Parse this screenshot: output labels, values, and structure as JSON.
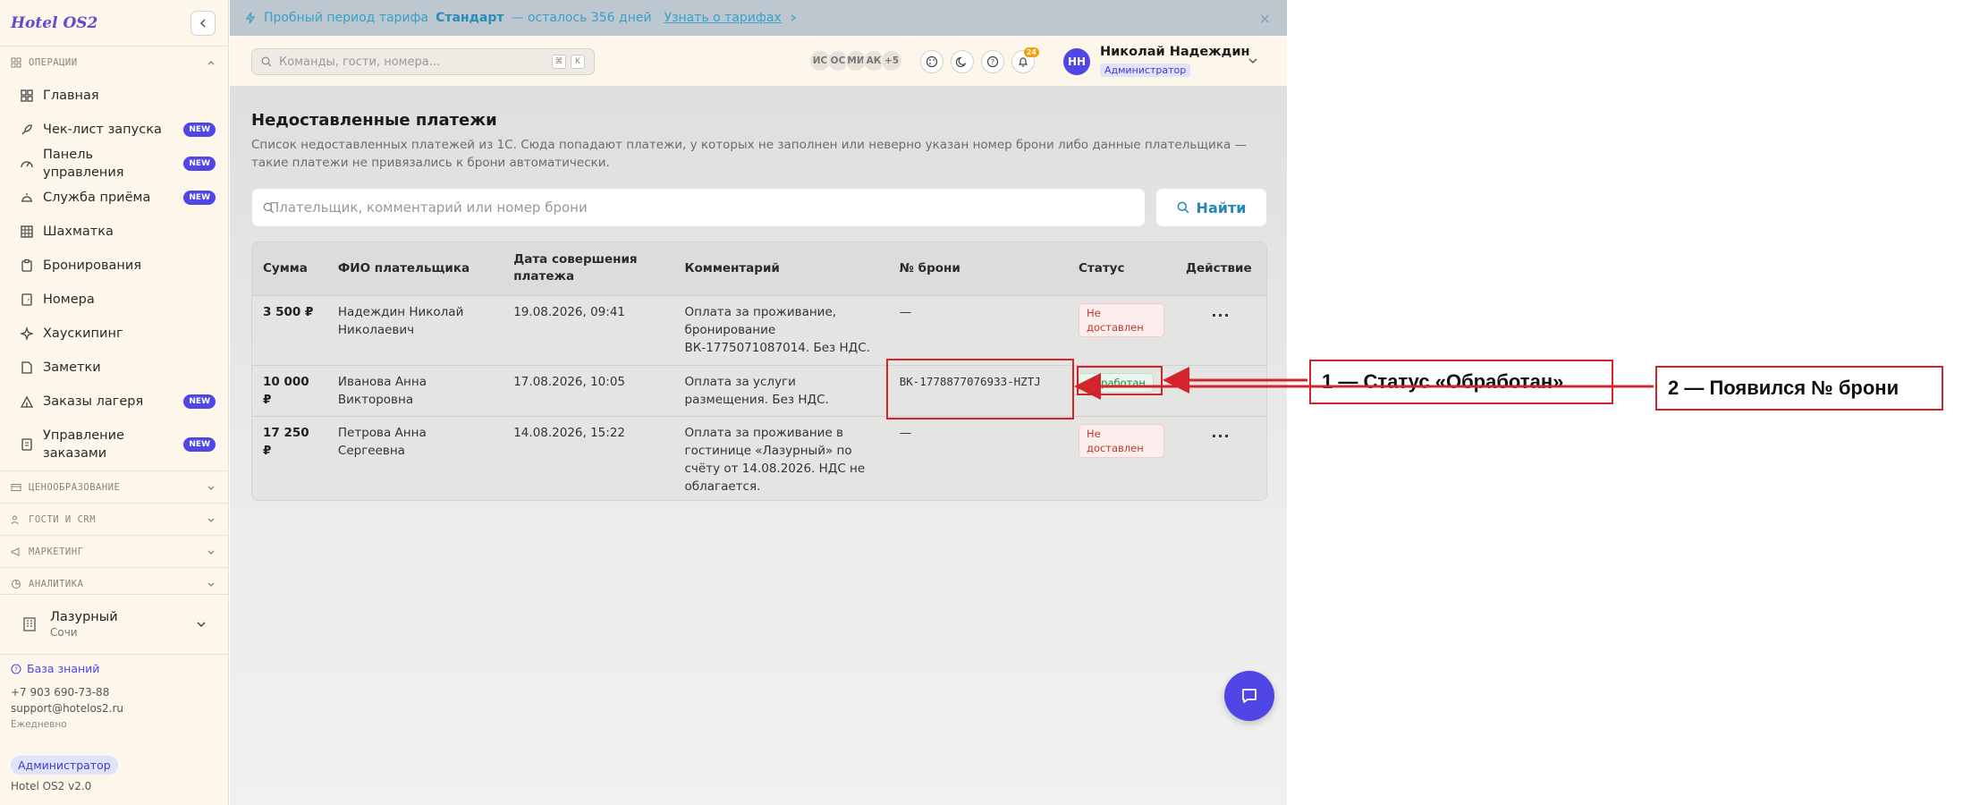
{
  "app": {
    "logo": "Hotel OS2"
  },
  "sidebar": {
    "group_operations": "ОПЕРАЦИИ",
    "items": [
      {
        "label": "Главная",
        "new": ""
      },
      {
        "label": "Чек-лист запуска",
        "new": "NEW"
      },
      {
        "label": "Панель управления",
        "new": "NEW"
      },
      {
        "label": "Служба приёма",
        "new": "NEW"
      },
      {
        "label": "Шахматка",
        "new": ""
      },
      {
        "label": "Бронирования",
        "new": ""
      },
      {
        "label": "Номера",
        "new": ""
      },
      {
        "label": "Хаускипинг",
        "new": ""
      },
      {
        "label": "Заметки",
        "new": ""
      },
      {
        "label": "Заказы лагеря",
        "new": "NEW"
      },
      {
        "label": "Управление заказами",
        "new": "NEW"
      }
    ],
    "groups": [
      "ЦЕНООБРАЗОВАНИЕ",
      "ГОСТИ И CRM",
      "МАРКЕТИНГ",
      "АНАЛИТИКА"
    ],
    "hotel": {
      "name": "Лазурный",
      "city": "Сочи"
    },
    "footer": {
      "knowledge_base": "База знаний",
      "phone": "+7 903 690-73-88",
      "email": "support@hotelos2.ru",
      "schedule": "Ежедневно",
      "role": "Администратор",
      "version": "Hotel OS2 v2.0"
    }
  },
  "trial": {
    "prefix": "Пробный период тарифа",
    "plan": "Стандарт",
    "suffix": "— осталось 356 дней",
    "link": "Узнать о тарифах",
    "close": "×"
  },
  "topbar": {
    "search_placeholder": "Команды, гости, номера...",
    "kbd": [
      "⌘",
      "K"
    ],
    "avatars": [
      "ИС",
      "ОС",
      "МИ",
      "АК",
      "+5"
    ],
    "notif_count": "24",
    "user": {
      "initials": "НН",
      "name": "Николай Надеждин",
      "role": "Администратор"
    }
  },
  "page": {
    "title": "Недоставленные платежи",
    "description": "Список недоставленных платежей из 1С. Сюда попадают платежи, у которых не заполнен или неверно указан номер брони либо данные плательщика — такие платежи не привязались к брони автоматически.",
    "filter_placeholder": "Плательщик, комментарий или номер брони",
    "find_label": "Найти"
  },
  "table": {
    "headers": [
      "Сумма",
      "ФИО плательщика",
      "Дата совершения платежа",
      "Комментарий",
      "№ брони",
      "Статус",
      "Действие"
    ],
    "rows": [
      {
        "amount": "3 500 ₽",
        "payer": "Надеждин Николай Николаевич",
        "date": "19.08.2026, 09:41",
        "comment": "Оплата за проживание, бронирование ВК-1775071087014. Без НДС.",
        "booking": "—",
        "status": "Не доставлен",
        "status_kind": "bad",
        "action": "..."
      },
      {
        "amount": "10 000 ₽",
        "payer": "Иванова Анна Викторовна",
        "date": "17.08.2026, 10:05",
        "comment": "Оплата за услуги размещения. Без НДС.",
        "booking": "BK-1778877076933-HZTJ",
        "status": "Обработан",
        "status_kind": "ok",
        "action": ""
      },
      {
        "amount": "17 250 ₽",
        "payer": "Петрова Анна Сергеевна",
        "date": "14.08.2026, 15:22",
        "comment": "Оплата за проживание в гостинице «Лазурный» по счёту от 14.08.2026. НДС не облагается.",
        "booking": "—",
        "status": "Не доставлен",
        "status_kind": "bad",
        "action": "..."
      }
    ]
  },
  "annotations": {
    "callout_1": "1 — Статус «Обработан»",
    "callout_2": "2 — Появился № брони"
  },
  "colors": {
    "accent": "#4f46e5",
    "annotation": "#d4242b",
    "status_ok": "#1e8a45",
    "status_bad": "#c0392b"
  }
}
